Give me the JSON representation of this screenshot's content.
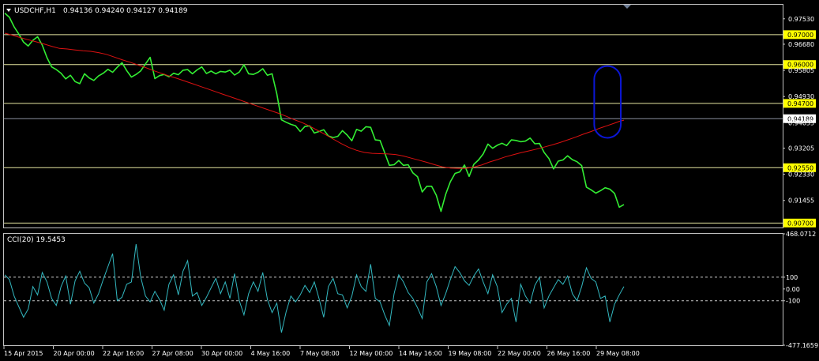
{
  "colors": {
    "background": "#000000",
    "frame": "#c0c0c0",
    "price_line": "#33ee33",
    "ma_line": "#dd1111",
    "level_line": "#e6e6a0",
    "level_label_bg": "#ffff00",
    "current_label_bg": "#ffffff",
    "cci_line": "#33b8c0",
    "cci_level": "#c8c8c8",
    "annotation": "#0b16d6",
    "text": "#ffffff",
    "marker": "#6e7e96"
  },
  "chart_data": [
    {
      "type": "line",
      "name": "price",
      "title": "USDCHF,H1",
      "ohlc": "0.94136 0.94240 0.94127 0.94189",
      "y_ticks": [
        "0.97530",
        "0.96680",
        "0.95805",
        "0.94930",
        "0.94055",
        "0.93205",
        "0.92330",
        "0.91455"
      ],
      "ylim": [
        0.9055,
        0.98
      ],
      "levels": [
        {
          "label": "0.97000",
          "value": 0.97
        },
        {
          "label": "0.96000",
          "value": 0.96
        },
        {
          "label": "0.94700",
          "value": 0.947
        },
        {
          "label": "0.92550",
          "value": 0.9255
        },
        {
          "label": "0.90700",
          "value": 0.907
        }
      ],
      "current": {
        "label": "0.94189",
        "value": 0.94189
      },
      "x_ticks": [
        "15 Apr 2015",
        "20 Apr 00:00",
        "22 Apr 16:00",
        "27 Apr 08:00",
        "30 Apr 00:00",
        "4 May 16:00",
        "7 May 08:00",
        "12 May 00:00",
        "14 May 16:00",
        "19 May 08:00",
        "22 May 00:00",
        "26 May 16:00",
        "29 May 08:00"
      ],
      "x": [
        0,
        3,
        6,
        9,
        12,
        15,
        18,
        21,
        24,
        27,
        30,
        33,
        36,
        39,
        42,
        45,
        48,
        51,
        54,
        57,
        60,
        63,
        66,
        69,
        72,
        75,
        78,
        81,
        84,
        87,
        90,
        93,
        96,
        99,
        102,
        105,
        108,
        111,
        114,
        117,
        120,
        123,
        126,
        129,
        132,
        135,
        138,
        141,
        144,
        147,
        150,
        153,
        156,
        159,
        162,
        165,
        168,
        171,
        174,
        177,
        180,
        183,
        186,
        189,
        192,
        195,
        198,
        201,
        204,
        207,
        210,
        213,
        216,
        219,
        222,
        225,
        228,
        231,
        234,
        237,
        240,
        243,
        246,
        249,
        252,
        255,
        258,
        261,
        264,
        267,
        270,
        273,
        276,
        279,
        282,
        285,
        288,
        291,
        294,
        297,
        300,
        303,
        306,
        309,
        312,
        315,
        318,
        321,
        324,
        327,
        330,
        333,
        336,
        339,
        342,
        345,
        348,
        351,
        354,
        357,
        360,
        363,
        366,
        369,
        372,
        375,
        378,
        381,
        384,
        387,
        390,
        393,
        396
      ],
      "series": [
        {
          "values": [
            0.9772,
            0.9758,
            0.9726,
            0.9702,
            0.9675,
            0.9662,
            0.9681,
            0.9693,
            0.9665,
            0.9623,
            0.9592,
            0.9583,
            0.9571,
            0.9552,
            0.9564,
            0.9543,
            0.9536,
            0.9569,
            0.9555,
            0.9547,
            0.9562,
            0.9571,
            0.9584,
            0.9574,
            0.9591,
            0.9606,
            0.958,
            0.9558,
            0.9567,
            0.9579,
            0.9602,
            0.9624,
            0.9553,
            0.9563,
            0.9567,
            0.9559,
            0.9571,
            0.9566,
            0.9581,
            0.9583,
            0.9569,
            0.9582,
            0.9592,
            0.957,
            0.9578,
            0.9569,
            0.9577,
            0.9575,
            0.9581,
            0.9565,
            0.9575,
            0.9599,
            0.9569,
            0.9567,
            0.9574,
            0.9586,
            0.9564,
            0.9569,
            0.9502,
            0.9415,
            0.9407,
            0.94,
            0.9395,
            0.9376,
            0.9393,
            0.9395,
            0.9371,
            0.9376,
            0.9382,
            0.9361,
            0.9356,
            0.936,
            0.9379,
            0.9364,
            0.9345,
            0.9383,
            0.9377,
            0.9392,
            0.939,
            0.9348,
            0.9346,
            0.9305,
            0.9263,
            0.9265,
            0.9279,
            0.9263,
            0.9265,
            0.9238,
            0.9225,
            0.9174,
            0.9193,
            0.9193,
            0.9163,
            0.9109,
            0.9166,
            0.9208,
            0.9236,
            0.9241,
            0.9264,
            0.9226,
            0.9266,
            0.9281,
            0.9301,
            0.9334,
            0.932,
            0.933,
            0.9337,
            0.9329,
            0.9348,
            0.9346,
            0.9342,
            0.9344,
            0.9354,
            0.9335,
            0.9336,
            0.9306,
            0.9286,
            0.9251,
            0.9277,
            0.9281,
            0.9295,
            0.9282,
            0.9275,
            0.9262,
            0.919,
            0.9181,
            0.917,
            0.9178,
            0.9188,
            0.9183,
            0.9169,
            0.9123,
            0.9132,
            0.9171,
            0.9133,
            0.9145,
            0.913,
            0.9145,
            0.9155,
            0.9176,
            0.9223,
            0.9195,
            0.9188,
            0.9191,
            0.9179,
            0.9214,
            0.9204,
            0.9249,
            0.9257,
            0.9255,
            0.9288,
            0.9336,
            0.9354,
            0.9361,
            0.9382,
            0.9375,
            0.9376,
            0.938,
            0.9382,
            0.9377,
            0.938,
            0.9379,
            0.9373,
            0.9342,
            0.9346,
            0.9353,
            0.9378,
            0.9383,
            0.9364,
            0.934,
            0.9357,
            0.9364,
            0.9366,
            0.935,
            0.933,
            0.9415,
            0.9421,
            0.943,
            0.9447,
            0.9433,
            0.9437,
            0.9437,
            0.9432,
            0.9438,
            0.944,
            0.944,
            0.9446,
            0.945,
            0.9462,
            0.9493,
            0.9492,
            0.9477,
            0.9506,
            0.9498,
            0.9501,
            0.951,
            0.9486,
            0.9488,
            0.9489,
            0.9484,
            0.9496,
            0.9495,
            0.9478,
            0.9471,
            0.9447,
            0.9436,
            0.9427,
            0.9418,
            0.9426,
            0.94,
            0.9457,
            0.9413,
            0.9415,
            0.9384,
            0.9411,
            0.9419
          ]
        },
        {
          "values": [
            0.9705,
            0.9698,
            0.969,
            0.9683,
            0.9676,
            0.9669,
            0.9661,
            0.9654,
            0.9652,
            0.9649,
            0.9646,
            0.9644,
            0.964,
            0.9634,
            0.9625,
            0.9616,
            0.9608,
            0.9599,
            0.959,
            0.958,
            0.9571,
            0.9562,
            0.9554,
            0.9545,
            0.9536,
            0.9527,
            0.9518,
            0.9509,
            0.95,
            0.9491,
            0.9482,
            0.9473,
            0.9464,
            0.9455,
            0.9446,
            0.9437,
            0.9427,
            0.9416,
            0.9406,
            0.9394,
            0.938,
            0.9366,
            0.9351,
            0.9336,
            0.9323,
            0.9313,
            0.9306,
            0.9303,
            0.9302,
            0.9301,
            0.9299,
            0.9294,
            0.9287,
            0.928,
            0.9273,
            0.9265,
            0.9258,
            0.9254,
            0.9253,
            0.9253,
            0.9257,
            0.9264,
            0.9274,
            0.9282,
            0.9291,
            0.9298,
            0.9305,
            0.9311,
            0.9317,
            0.9324,
            0.9331,
            0.9339,
            0.9348,
            0.9357,
            0.9367,
            0.9376,
            0.9386,
            0.9395,
            0.9404,
            0.941,
            0.9414,
            0.9415,
            0.9416
          ]
        }
      ],
      "ma_x": [
        0,
        5,
        10,
        15,
        20,
        25,
        30,
        35,
        40,
        45,
        50,
        55,
        60,
        65,
        70,
        75,
        80,
        85,
        90,
        95,
        100,
        105,
        110,
        115,
        120,
        125,
        130,
        135,
        140,
        145,
        150,
        155,
        160,
        165,
        170,
        175,
        180,
        185,
        190,
        195,
        200,
        205,
        210,
        215,
        220,
        225,
        230,
        235,
        240,
        245,
        250,
        255,
        260,
        265,
        270,
        275,
        280,
        285,
        290,
        295,
        300,
        305,
        310,
        315,
        320,
        325,
        330,
        335,
        340,
        345,
        350,
        355,
        360,
        365,
        370,
        375,
        380,
        385,
        390,
        393,
        396
      ],
      "annotation": {
        "x_from": 377,
        "x_to": 394,
        "y_from": 0.9355,
        "y_to": 0.9595
      }
    },
    {
      "type": "line",
      "name": "cci",
      "title": "CCI(20) 19.5453",
      "y_ticks": [
        "468.0712",
        "100",
        "0.00",
        "-100",
        "-477.1659"
      ],
      "ylim": [
        -477.1659,
        468.0712
      ],
      "levels": [
        100,
        -100
      ],
      "x": [
        0,
        3,
        6,
        9,
        12,
        15,
        18,
        21,
        24,
        27,
        30,
        33,
        36,
        39,
        42,
        45,
        48,
        51,
        54,
        57,
        60,
        63,
        66,
        69,
        72,
        75,
        78,
        81,
        84,
        87,
        90,
        93,
        96,
        99,
        102,
        105,
        108,
        111,
        114,
        117,
        120,
        123,
        126,
        129,
        132,
        135,
        138,
        141,
        144,
        147,
        150,
        153,
        156,
        159,
        162,
        165,
        168,
        171,
        174,
        177,
        180,
        183,
        186,
        189,
        192,
        195,
        198,
        201,
        204,
        207,
        210,
        213,
        216,
        219,
        222,
        225,
        228,
        231,
        234,
        237,
        240,
        243,
        246,
        249,
        252,
        255,
        258,
        261,
        264,
        267,
        270,
        273,
        276,
        279,
        282,
        285,
        288,
        291,
        294,
        297,
        300,
        303,
        306,
        309,
        312,
        315,
        318,
        321,
        324,
        327,
        330,
        333,
        336,
        339,
        342,
        345,
        348,
        351,
        354,
        357,
        360,
        363,
        366,
        369,
        372,
        375,
        378,
        381,
        384,
        387,
        390,
        393,
        396
      ],
      "values": [
        120,
        80,
        -60,
        -150,
        -240,
        -170,
        20,
        -50,
        140,
        60,
        -80,
        -140,
        20,
        110,
        -130,
        70,
        150,
        50,
        10,
        -120,
        -40,
        80,
        190,
        300,
        -100,
        -70,
        40,
        60,
        380,
        100,
        -60,
        -110,
        -20,
        -90,
        -180,
        40,
        120,
        -50,
        150,
        240,
        -60,
        -30,
        -140,
        -70,
        10,
        90,
        -40,
        60,
        -80,
        130,
        -100,
        -220,
        -40,
        60,
        -20,
        140,
        -90,
        -200,
        -120,
        -370,
        -190,
        -60,
        -110,
        -50,
        30,
        -30,
        60,
        -80,
        -240,
        20,
        90,
        -40,
        -50,
        -160,
        -60,
        120,
        20,
        -20,
        210,
        -80,
        -110,
        -220,
        -310,
        -40,
        120,
        60,
        -30,
        -80,
        -160,
        -250,
        60,
        130,
        20,
        -140,
        -40,
        80,
        190,
        140,
        70,
        30,
        110,
        170,
        60,
        -40,
        120,
        20,
        -200,
        -130,
        -80,
        -280,
        40,
        -60,
        -120,
        30,
        100,
        -160,
        -60,
        10,
        80,
        40,
        110,
        -40,
        -100,
        20,
        180,
        90,
        60,
        -80,
        -60,
        -280,
        -130,
        -50,
        20
      ]
    }
  ]
}
